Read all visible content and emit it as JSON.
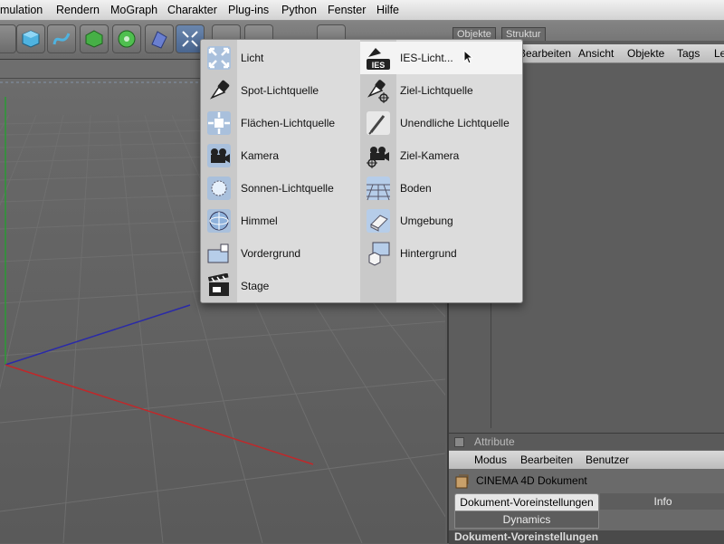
{
  "menubar": {
    "items": [
      "mulation",
      "Rendern",
      "MoGraph",
      "Charakter",
      "Plug-ins",
      "Python",
      "Fenster",
      "Hilfe"
    ]
  },
  "toolbar": {
    "icons": [
      "cube-icon",
      "spline-icon",
      "nurbs-icon",
      "array-icon",
      "deformer-icon",
      "light-icon"
    ]
  },
  "object_panel": {
    "tabs": [
      "Objekte",
      "Struktur"
    ],
    "menu": [
      "Bearbeiten",
      "Ansicht",
      "Objekte",
      "Tags",
      "Le"
    ]
  },
  "attribute_panel": {
    "title": "Attribute",
    "menu": [
      "Modus",
      "Bearbeiten",
      "Benutzer"
    ],
    "document_title": "CINEMA 4D Dokument",
    "tabs": [
      "Dokument-Voreinstellungen",
      "Info",
      "Dynamics"
    ],
    "section_title": "Dokument-Voreinstellungen"
  },
  "light_menu": {
    "left": [
      {
        "label": "Licht",
        "icon": "omni-light-icon"
      },
      {
        "label": "Spot-Lichtquelle",
        "icon": "spot-light-icon"
      },
      {
        "label": "Flächen-Lichtquelle",
        "icon": "area-light-icon"
      },
      {
        "label": "Kamera",
        "icon": "camera-icon"
      },
      {
        "label": "Sonnen-Lichtquelle",
        "icon": "sun-light-icon"
      },
      {
        "label": "Himmel",
        "icon": "sky-icon"
      },
      {
        "label": "Vordergrund",
        "icon": "foreground-icon"
      },
      {
        "label": "Stage",
        "icon": "stage-icon"
      }
    ],
    "right": [
      {
        "label": "IES-Licht...",
        "icon": "ies-light-icon"
      },
      {
        "label": "Ziel-Lichtquelle",
        "icon": "target-light-icon"
      },
      {
        "label": "Unendliche Lichtquelle",
        "icon": "infinite-light-icon"
      },
      {
        "label": "Ziel-Kamera",
        "icon": "target-camera-icon"
      },
      {
        "label": "Boden",
        "icon": "floor-icon"
      },
      {
        "label": "Umgebung",
        "icon": "environment-icon"
      },
      {
        "label": "Hintergrund",
        "icon": "background-icon"
      }
    ],
    "ies_badge": "IES"
  },
  "colors": {
    "viewport": "#5e5e5e",
    "x_axis": "#c0282a",
    "y_axis": "#2a9a35",
    "z_axis": "#2a2aa8"
  }
}
